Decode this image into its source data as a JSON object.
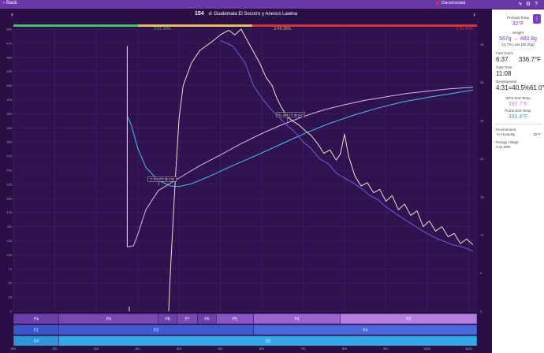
{
  "topbar": {
    "back_label": "Back",
    "status_text": "Disconnected",
    "icons": [
      "flash-icon",
      "settings-icon",
      "help-icon"
    ]
  },
  "header": {
    "roast_number": "154",
    "bean_name": "d: Guatemala El Socorro y Anexos Lawina"
  },
  "phase_labels": [
    {
      "label": "3:01-34%",
      "color": "#42c06a"
    },
    {
      "label": "2:46-26%",
      "color": "#e8c15a"
    },
    {
      "label": "4:31-40%",
      "color": "#d8313f"
    }
  ],
  "annotations": [
    {
      "label": "T: 223.0°F @ 3:31",
      "x_min": 3.52,
      "y": 223
    },
    {
      "label": "FC: 336.7°F @ 6:37",
      "x_min": 6.62,
      "y": 337
    }
  ],
  "chart_data": {
    "type": "line",
    "x_unit": "min",
    "x_ticks": [
      "0m",
      "1m",
      "2m",
      "3m",
      "4m",
      "5m",
      "6m",
      "7m",
      "8m",
      "9m",
      "10m",
      "11m"
    ],
    "y_left_ticks": [
      0,
      25,
      50,
      75,
      100,
      125,
      150,
      175,
      200,
      225,
      250,
      275,
      300,
      325,
      350,
      375,
      400,
      425,
      450,
      475,
      500
    ],
    "y_right_ticks": [
      0,
      5,
      10,
      15,
      20,
      25,
      30,
      35
    ],
    "xlim": [
      0,
      11.2
    ],
    "ylim": [
      0,
      500
    ],
    "y2lim": [
      0,
      37
    ],
    "series": [
      {
        "role": "bean-probe",
        "color": "#4ec0e8",
        "axis": "left",
        "points": [
          [
            2.75,
            346
          ],
          [
            2.85,
            330
          ],
          [
            3.0,
            290
          ],
          [
            3.2,
            255
          ],
          [
            3.5,
            232
          ],
          [
            3.8,
            222
          ],
          [
            4.0,
            221
          ],
          [
            4.3,
            226
          ],
          [
            4.7,
            238
          ],
          [
            5.2,
            255
          ],
          [
            5.8,
            274
          ],
          [
            6.4,
            294
          ],
          [
            7.0,
            314
          ],
          [
            7.6,
            332
          ],
          [
            8.2,
            347
          ],
          [
            8.8,
            360
          ],
          [
            9.4,
            371
          ],
          [
            10.0,
            379
          ],
          [
            10.6,
            386
          ],
          [
            11.1,
            392
          ]
        ]
      },
      {
        "role": "ibts",
        "color": "#d9b8f0",
        "axis": "left",
        "points": [
          [
            2.75,
            114
          ],
          [
            2.9,
            116
          ],
          [
            3.0,
            135
          ],
          [
            3.2,
            180
          ],
          [
            3.5,
            214
          ],
          [
            4.0,
            236
          ],
          [
            4.5,
            258
          ],
          [
            5.0,
            277
          ],
          [
            5.5,
            297
          ],
          [
            6.0,
            315
          ],
          [
            6.5,
            331
          ],
          [
            7.0,
            345
          ],
          [
            7.5,
            357
          ],
          [
            8.0,
            366
          ],
          [
            8.5,
            374
          ],
          [
            9.0,
            380
          ],
          [
            9.5,
            386
          ],
          [
            10.0,
            390
          ],
          [
            10.5,
            394
          ],
          [
            11.1,
            397
          ]
        ]
      },
      {
        "role": "ror-ibts",
        "color": "#ece0c8",
        "axis": "left",
        "points": [
          [
            3.75,
            0
          ],
          [
            3.8,
            80
          ],
          [
            3.9,
            220
          ],
          [
            4.0,
            340
          ],
          [
            4.1,
            400
          ],
          [
            4.3,
            440
          ],
          [
            4.5,
            462
          ],
          [
            4.8,
            478
          ],
          [
            5.0,
            490
          ],
          [
            5.2,
            498
          ],
          [
            5.35,
            490
          ],
          [
            5.5,
            500
          ],
          [
            5.65,
            480
          ],
          [
            5.8,
            460
          ],
          [
            5.95,
            440
          ],
          [
            6.1,
            415
          ],
          [
            6.25,
            400
          ],
          [
            6.35,
            380
          ],
          [
            6.45,
            365
          ],
          [
            6.6,
            346
          ],
          [
            6.75,
            337
          ],
          [
            6.9,
            330
          ],
          [
            7.05,
            320
          ],
          [
            7.2,
            311
          ],
          [
            7.35,
            297
          ],
          [
            7.5,
            280
          ],
          [
            7.65,
            286
          ],
          [
            7.8,
            268
          ],
          [
            7.9,
            279
          ],
          [
            8.0,
            314
          ],
          [
            8.1,
            274
          ],
          [
            8.25,
            240
          ],
          [
            8.4,
            222
          ],
          [
            8.55,
            228
          ],
          [
            8.7,
            210
          ],
          [
            8.85,
            216
          ],
          [
            9.0,
            195
          ],
          [
            9.15,
            205
          ],
          [
            9.3,
            180
          ],
          [
            9.45,
            190
          ],
          [
            9.6,
            170
          ],
          [
            9.75,
            178
          ],
          [
            9.9,
            150
          ],
          [
            10.05,
            160
          ],
          [
            10.2,
            142
          ],
          [
            10.35,
            150
          ],
          [
            10.5,
            132
          ],
          [
            10.65,
            138
          ],
          [
            10.8,
            120
          ],
          [
            10.95,
            128
          ],
          [
            11.1,
            118
          ]
        ]
      },
      {
        "role": "ror-probe",
        "color": "#6a5fd8",
        "axis": "left",
        "points": [
          [
            5.0,
            480
          ],
          [
            5.3,
            470
          ],
          [
            5.6,
            440
          ],
          [
            5.8,
            400
          ],
          [
            6.0,
            378
          ],
          [
            6.2,
            360
          ],
          [
            6.4,
            345
          ],
          [
            6.6,
            330
          ],
          [
            6.8,
            318
          ],
          [
            7.0,
            300
          ],
          [
            7.2,
            288
          ],
          [
            7.4,
            270
          ],
          [
            7.6,
            262
          ],
          [
            7.8,
            245
          ],
          [
            8.0,
            236
          ],
          [
            8.2,
            228
          ],
          [
            8.4,
            218
          ],
          [
            8.6,
            206
          ],
          [
            8.8,
            198
          ],
          [
            9.0,
            185
          ],
          [
            9.2,
            175
          ],
          [
            9.4,
            165
          ],
          [
            9.6,
            156
          ],
          [
            9.8,
            146
          ],
          [
            10.0,
            138
          ],
          [
            10.2,
            130
          ],
          [
            10.4,
            124
          ],
          [
            10.6,
            118
          ],
          [
            10.8,
            115
          ],
          [
            11.0,
            110
          ],
          [
            11.1,
            106
          ]
        ]
      }
    ],
    "drop_lines": [
      {
        "x": 2.75,
        "y_top": 470,
        "y_bottom": 114
      },
      {
        "x": 2.8,
        "y_top": 8,
        "y_bottom": 0
      }
    ]
  },
  "rows": [
    {
      "segments": [
        {
          "label": "P4",
          "x0": 0,
          "x1": 1.1,
          "color": "#6b3fa8"
        },
        {
          "label": "P9",
          "x0": 1.1,
          "x1": 3.5,
          "color": "#7a48b5"
        },
        {
          "label": "P8",
          "x0": 3.5,
          "x1": 3.95,
          "color": "#6e40ac"
        },
        {
          "label": "P7",
          "x0": 3.95,
          "x1": 4.45,
          "color": "#7a48b5"
        },
        {
          "label": "P6",
          "x0": 4.45,
          "x1": 4.9,
          "color": "#6e40ac"
        },
        {
          "label": "P5",
          "x0": 4.9,
          "x1": 5.8,
          "color": "#8a55c4"
        },
        {
          "label": "P4",
          "x0": 5.8,
          "x1": 7.9,
          "color": "#9a64d2"
        },
        {
          "label": "P2",
          "x0": 7.9,
          "x1": 11.2,
          "color": "#b37ee0"
        }
      ]
    },
    {
      "segments": [
        {
          "label": "F2",
          "x0": 0,
          "x1": 1.1,
          "color": "#3a56c8"
        },
        {
          "label": "F3",
          "x0": 1.1,
          "x1": 5.8,
          "color": "#3f5bcf"
        },
        {
          "label": "F4",
          "x0": 5.8,
          "x1": 11.2,
          "color": "#4a68dc"
        }
      ]
    },
    {
      "segments": [
        {
          "label": "D4",
          "x0": 0,
          "x1": 1.1,
          "color": "#2f95d8"
        },
        {
          "label": "D3",
          "x0": 1.1,
          "x1": 11.2,
          "color": "#36a8e8"
        }
      ]
    }
  ],
  "side": {
    "preheat_label": "Preheat Temp",
    "preheat_value": "32°F",
    "weight_label": "Weight",
    "weight_value": "567g → 483.8g",
    "weight_loss": "14.7% Loss (83.20g)",
    "first_crack_label": "First Crack",
    "first_crack_time": "6:37",
    "first_crack_temp": "336.7°F",
    "total_time_label": "Total Time",
    "total_time_value": "11:08",
    "development_label": "Development",
    "development_value": "4:31=40.5%",
    "development_temp": "61.0°F",
    "ibts_end_label": "IBTS End Temp",
    "ibts_end_value": "397.7°F",
    "probe_end_label": "Probe End Temp",
    "probe_end_value": "391.4°F",
    "environment_label": "Environment",
    "humidity_value": "-% Humidity",
    "ambient_value": "32°F",
    "energy_label": "Energy Usage",
    "energy_value": "0.11 kWh",
    "menu_icon": "kebab-menu-icon"
  }
}
